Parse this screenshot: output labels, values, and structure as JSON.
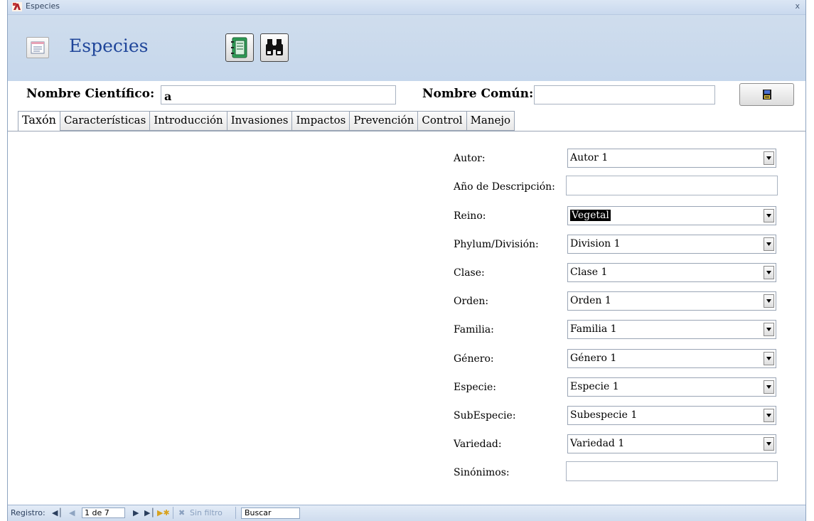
{
  "window": {
    "title": "Especies",
    "close_label": "x"
  },
  "header": {
    "title": "Especies"
  },
  "search_bar": {
    "scientific_label": "Nombre Científico:",
    "scientific_value": "a",
    "common_label": "Nombre Común:",
    "common_value": ""
  },
  "tabs": [
    {
      "label": "Taxón",
      "active": true
    },
    {
      "label": "Características",
      "active": false
    },
    {
      "label": "Introducción",
      "active": false
    },
    {
      "label": "Invasiones",
      "active": false
    },
    {
      "label": "Impactos",
      "active": false
    },
    {
      "label": "Prevención",
      "active": false
    },
    {
      "label": "Control",
      "active": false
    },
    {
      "label": "Manejo",
      "active": false
    }
  ],
  "fields": {
    "autor": {
      "label": "Autor:",
      "value": "Autor 1"
    },
    "anio": {
      "label": "Año de Descripción:",
      "value": ""
    },
    "reino": {
      "label": "Reino:",
      "value": "Vegetal"
    },
    "phylum": {
      "label": "Phylum/División:",
      "value": "Division 1"
    },
    "clase": {
      "label": "Clase:",
      "value": "Clase 1"
    },
    "orden": {
      "label": "Orden:",
      "value": "Orden 1"
    },
    "familia": {
      "label": "Familia:",
      "value": "Familia 1"
    },
    "genero": {
      "label": "Género:",
      "value": "Género 1"
    },
    "especie": {
      "label": "Especie:",
      "value": "Especie 1"
    },
    "subespecie": {
      "label": "SubEspecie:",
      "value": "Subespecie 1"
    },
    "variedad": {
      "label": "Variedad:",
      "value": "Variedad 1"
    },
    "sinonimos": {
      "label": "Sinónimos:",
      "value": ""
    }
  },
  "statusbar": {
    "record_label": "Registro:",
    "record_value": "1 de 7",
    "filter_label": "Sin filtro",
    "search_label": "Buscar"
  },
  "colors": {
    "header_bg": "#c6d7ec",
    "title_blue": "#20469a"
  },
  "icons": [
    "access-app-icon",
    "form-icon",
    "notebook-icon",
    "binoculars-icon",
    "save-icon",
    "dropdown-arrow-icon",
    "filter-icon"
  ]
}
